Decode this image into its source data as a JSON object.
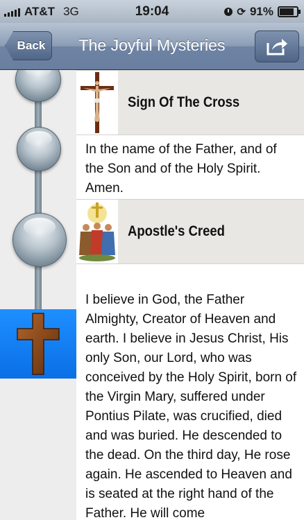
{
  "status_bar": {
    "carrier": "AT&T",
    "network": "3G",
    "time": "19:04",
    "battery": "91%",
    "battery_level": 0.91
  },
  "nav": {
    "back_label": "Back",
    "title": "The Joyful Mysteries",
    "share_icon": "share-icon"
  },
  "sections": [
    {
      "title": "Sign Of The Cross",
      "text": "In the name of the Father, and of the Son and of the Holy Spirit. Amen.",
      "thumb_icon": "crucifix-icon"
    },
    {
      "title": "Apostle's Creed",
      "text": "I believe in God, the Father Almighty, Creator of Heaven and earth. I believe in Jesus Christ, His only Son, our Lord, who was conceived by the Holy Spirit, born of the Virgin Mary, suffered under Pontius Pilate, was crucified, died and was buried. He descended to the dead. On the third day, He rose again. He ascended to Heaven and is seated at the right hand of the Father. He will come",
      "thumb_icon": "apostles-icon"
    }
  ],
  "sidebar": {
    "selected_icon": "cross-icon",
    "selected_color": "#0a7bf0"
  }
}
